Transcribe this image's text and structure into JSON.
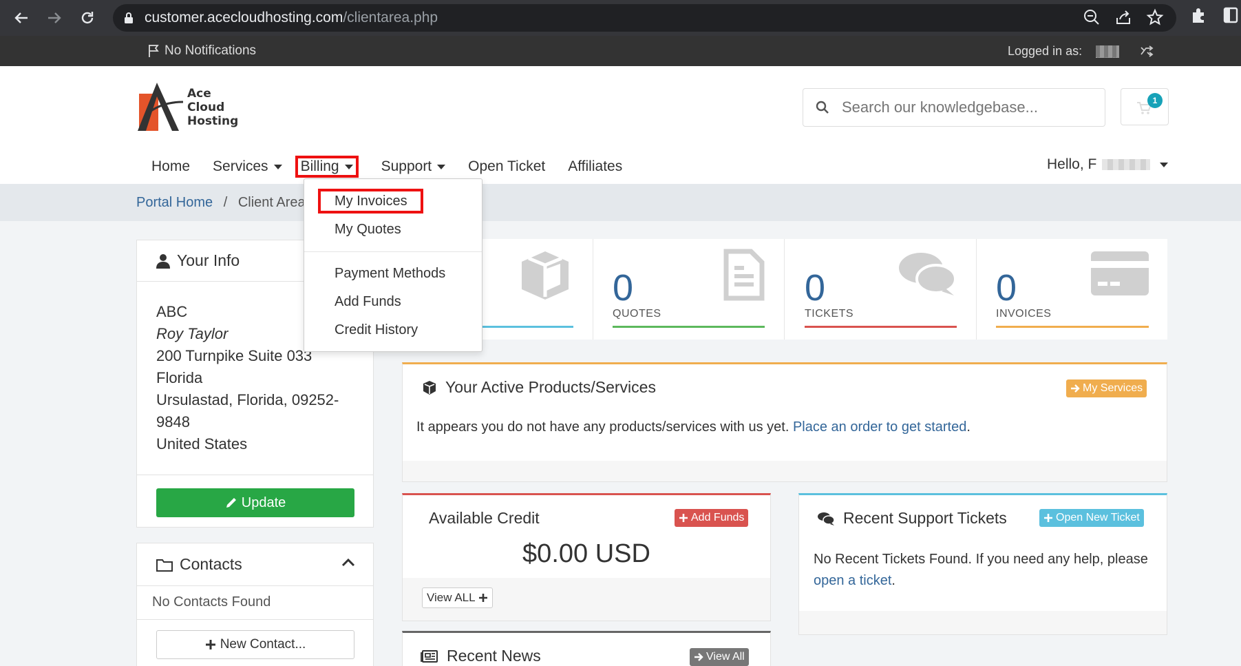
{
  "browser": {
    "url_host": "customer.acecloudhosting.com",
    "url_path": "/clientarea.php"
  },
  "topbar": {
    "notifications": "No Notifications",
    "logged_in_label": "Logged in as:"
  },
  "logo": {
    "line1": "Ace",
    "line2": "Cloud",
    "line3": "Hosting"
  },
  "search": {
    "placeholder": "Search our knowledgebase..."
  },
  "cart": {
    "count": "1"
  },
  "nav": {
    "home": "Home",
    "services": "Services",
    "billing": "Billing",
    "support": "Support",
    "open_ticket": "Open Ticket",
    "affiliates": "Affiliates",
    "hello": "Hello, F"
  },
  "breadcrumb": {
    "home": "Portal Home",
    "sep": "/",
    "current": "Client Area"
  },
  "billing_menu": {
    "items": [
      "My Invoices",
      "My Quotes",
      "Payment Methods",
      "Add Funds",
      "Credit History"
    ]
  },
  "your_info": {
    "title": "Your Info",
    "company": "ABC",
    "name": "Roy Taylor",
    "address1": "200 Turnpike Suite 033",
    "address2": "Florida",
    "city_line": "Ursulastad, Florida, 09252-",
    "zip_tail": "9848",
    "country": "United States",
    "update_label": "Update"
  },
  "contacts": {
    "title": "Contacts",
    "empty": "No Contacts Found",
    "new_label": "New Contact..."
  },
  "stats": [
    {
      "value": "0",
      "label": "QUOTES",
      "color": "#5cb85c"
    },
    {
      "value": "0",
      "label": "TICKETS",
      "color": "#d9534f"
    },
    {
      "value": "0",
      "label": "INVOICES",
      "color": "#f0ad4e"
    }
  ],
  "services_panel": {
    "title": "Your Active Products/Services",
    "button": "My Services",
    "text": "It appears you do not have any products/services with us yet.",
    "link": "Place an order to get started",
    "period": "."
  },
  "credit_panel": {
    "title": "Available Credit",
    "button": "Add Funds",
    "amount": "$0.00 USD",
    "view_all": "View ALL"
  },
  "tickets_panel": {
    "title": "Recent Support Tickets",
    "button": "Open New Ticket",
    "text": "No Recent Tickets Found. If you need any help, please",
    "link": "open a ticket",
    "period": "."
  },
  "news_panel": {
    "title": "Recent News",
    "button": "View All"
  }
}
